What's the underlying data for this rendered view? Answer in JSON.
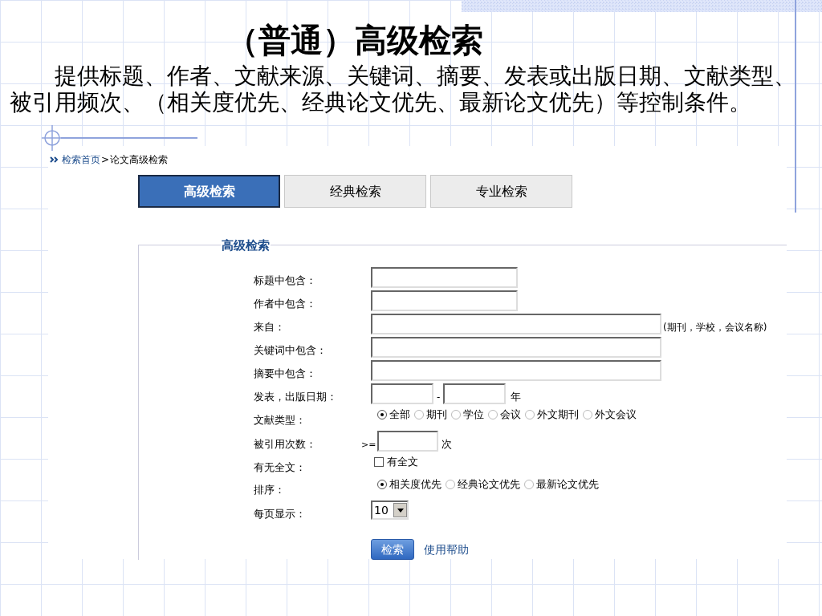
{
  "slide": {
    "title": "（普通）高级检索",
    "intro": "提供标题、作者、文献来源、关键词、摘要、发表或出版日期、文献类型、被引用频次、（相关度优先、经典论文优先、最新论文优先）等控制条件。"
  },
  "breadcrumb": {
    "home": "检索首页",
    "separator": ">",
    "current": "论文高级检索"
  },
  "tabs": [
    {
      "label": "高级检索",
      "selected": true
    },
    {
      "label": "经典检索",
      "selected": false
    },
    {
      "label": "专业检索",
      "selected": false
    }
  ],
  "form": {
    "legend": "高级检索",
    "rows": [
      {
        "kind": "short",
        "label": "标题中包含："
      },
      {
        "kind": "short",
        "label": "作者中包含："
      },
      {
        "kind": "long",
        "label": "来自：",
        "note": "(期刊，学校，会议名称)"
      },
      {
        "kind": "long",
        "label": "关键词中包含："
      },
      {
        "kind": "long",
        "label": "摘要中包含："
      },
      {
        "kind": "range",
        "label": "发表，出版日期：",
        "separator": "-",
        "unit": "年"
      },
      {
        "kind": "radio",
        "label": "文献类型：",
        "options": [
          {
            "label": "全部",
            "selected": true
          },
          {
            "label": "期刊",
            "selected": false
          },
          {
            "label": "学位",
            "selected": false
          },
          {
            "label": "会议",
            "selected": false
          },
          {
            "label": "外文期刊",
            "selected": false
          },
          {
            "label": "外文会议",
            "selected": false
          }
        ]
      },
      {
        "kind": "number",
        "label": "被引用次数：",
        "prefix": ">=",
        "unit": "次"
      },
      {
        "kind": "checkbox",
        "label": "有无全文：",
        "option": {
          "label": "有全文",
          "checked": false
        }
      },
      {
        "kind": "radio",
        "label": "排序：",
        "options": [
          {
            "label": "相关度优先",
            "selected": true
          },
          {
            "label": "经典论文优先",
            "selected": false
          },
          {
            "label": "最新论文优先",
            "selected": false
          }
        ]
      },
      {
        "kind": "select",
        "label": "每页显示：",
        "value": "10"
      }
    ],
    "search_button": "检索",
    "help_link": "使用帮助"
  }
}
